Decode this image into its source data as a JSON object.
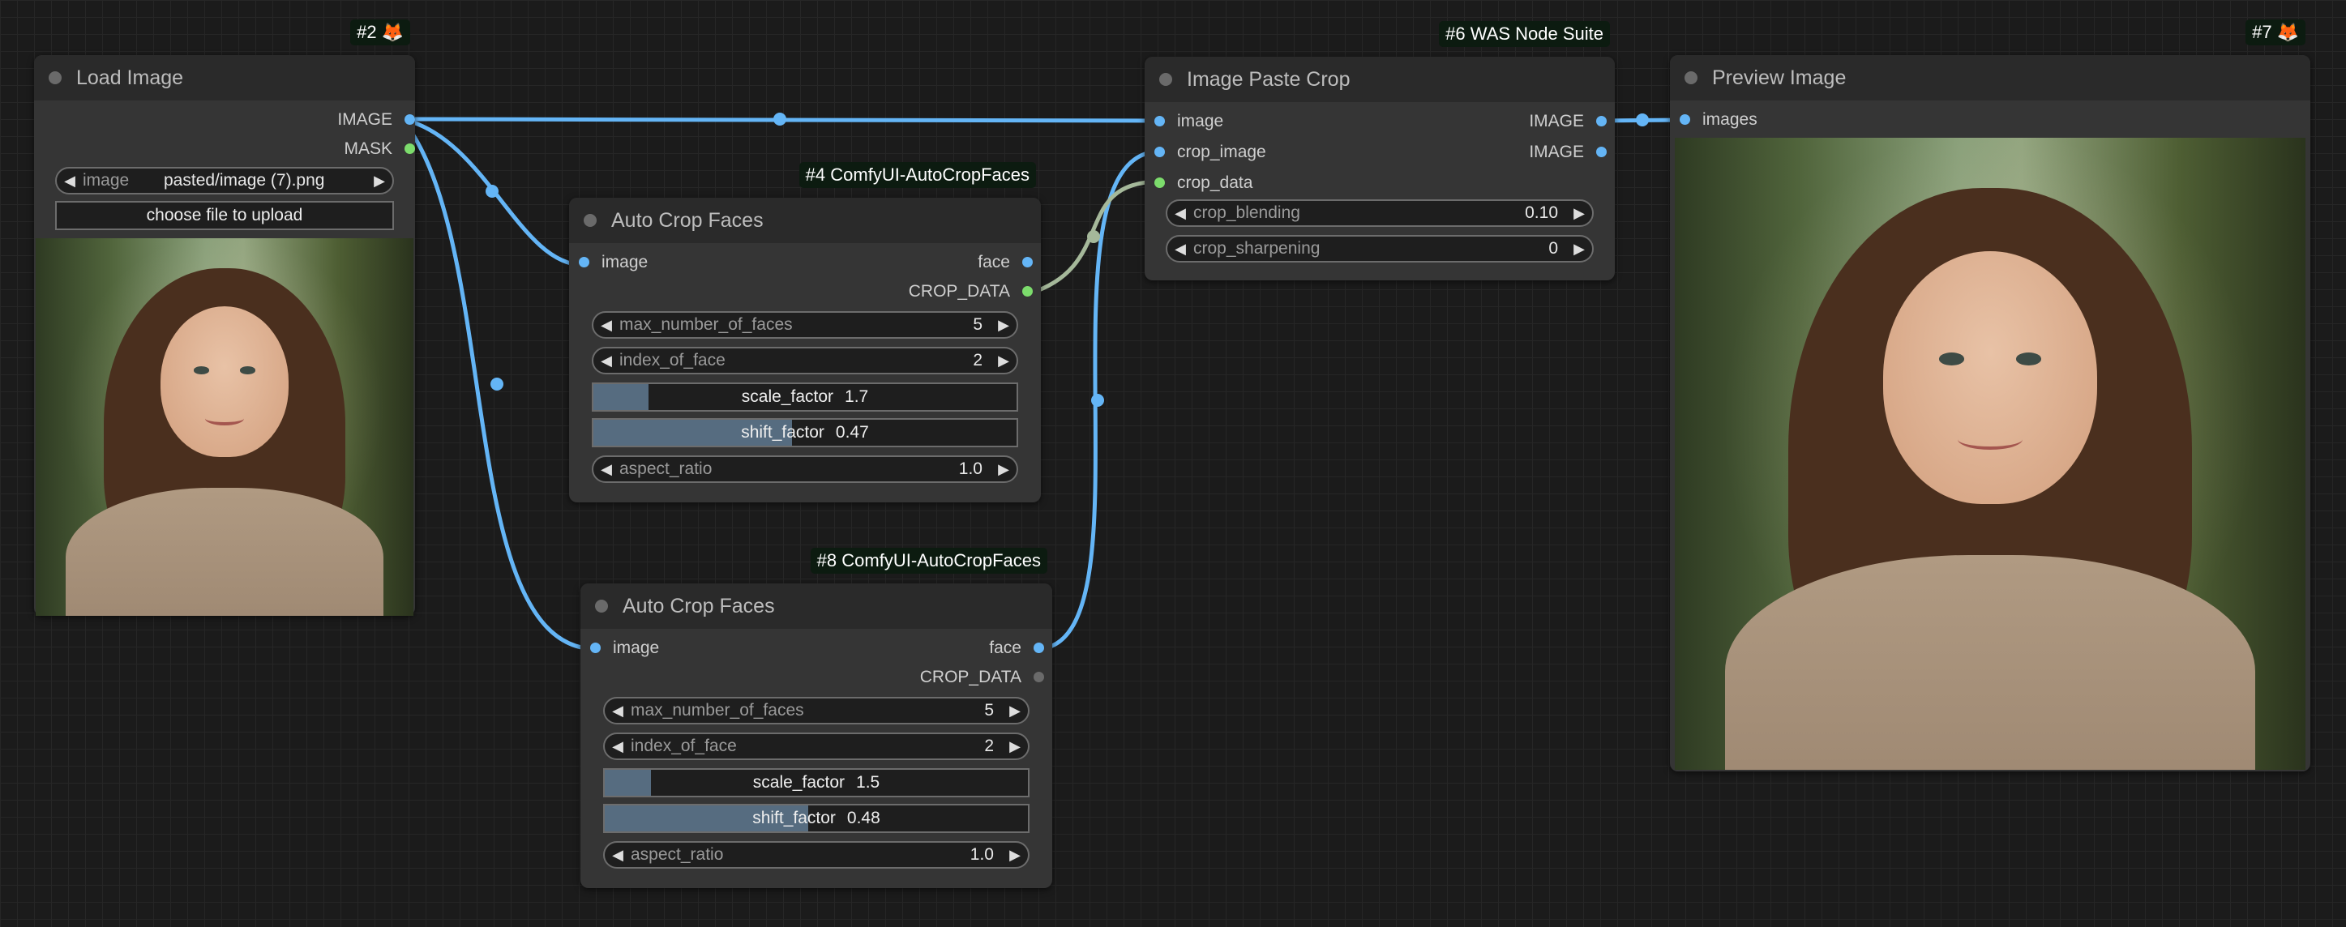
{
  "colors": {
    "image_wire": "#64b5f6",
    "crop_data_wire": "#a5b89a",
    "badge_bg": "#0c1b10",
    "node_bg": "#353535"
  },
  "nodes": {
    "load_image": {
      "title": "Load Image",
      "badge": "#2",
      "outputs": [
        "IMAGE",
        "MASK"
      ],
      "image_widget": {
        "label": "image",
        "value": "pasted/image (7).png"
      },
      "upload_label": "choose file to upload"
    },
    "crop4": {
      "title": "Auto Crop Faces",
      "badge": "#4 ComfyUI-AutoCropFaces",
      "input": "image",
      "outputs": [
        "face",
        "CROP_DATA"
      ],
      "max_number_of_faces": {
        "label": "max_number_of_faces",
        "value": "5"
      },
      "index_of_face": {
        "label": "index_of_face",
        "value": "2"
      },
      "scale_factor": {
        "label": "scale_factor",
        "value": "1.7",
        "fill": 0.13
      },
      "shift_factor": {
        "label": "shift_factor",
        "value": "0.47",
        "fill": 0.47
      },
      "aspect_ratio": {
        "label": "aspect_ratio",
        "value": "1.0"
      }
    },
    "crop8": {
      "title": "Auto Crop Faces",
      "badge": "#8 ComfyUI-AutoCropFaces",
      "input": "image",
      "outputs": [
        "face",
        "CROP_DATA"
      ],
      "max_number_of_faces": {
        "label": "max_number_of_faces",
        "value": "5"
      },
      "index_of_face": {
        "label": "index_of_face",
        "value": "2"
      },
      "scale_factor": {
        "label": "scale_factor",
        "value": "1.5",
        "fill": 0.11
      },
      "shift_factor": {
        "label": "shift_factor",
        "value": "0.48",
        "fill": 0.48
      },
      "aspect_ratio": {
        "label": "aspect_ratio",
        "value": "1.0"
      }
    },
    "paste": {
      "title": "Image Paste Crop",
      "badge": "#6 WAS Node Suite",
      "inputs": [
        "image",
        "crop_image",
        "crop_data"
      ],
      "outputs": [
        "IMAGE",
        "IMAGE"
      ],
      "crop_blending": {
        "label": "crop_blending",
        "value": "0.10"
      },
      "crop_sharpening": {
        "label": "crop_sharpening",
        "value": "0"
      }
    },
    "preview": {
      "title": "Preview Image",
      "badge": "#7",
      "input": "images"
    }
  }
}
